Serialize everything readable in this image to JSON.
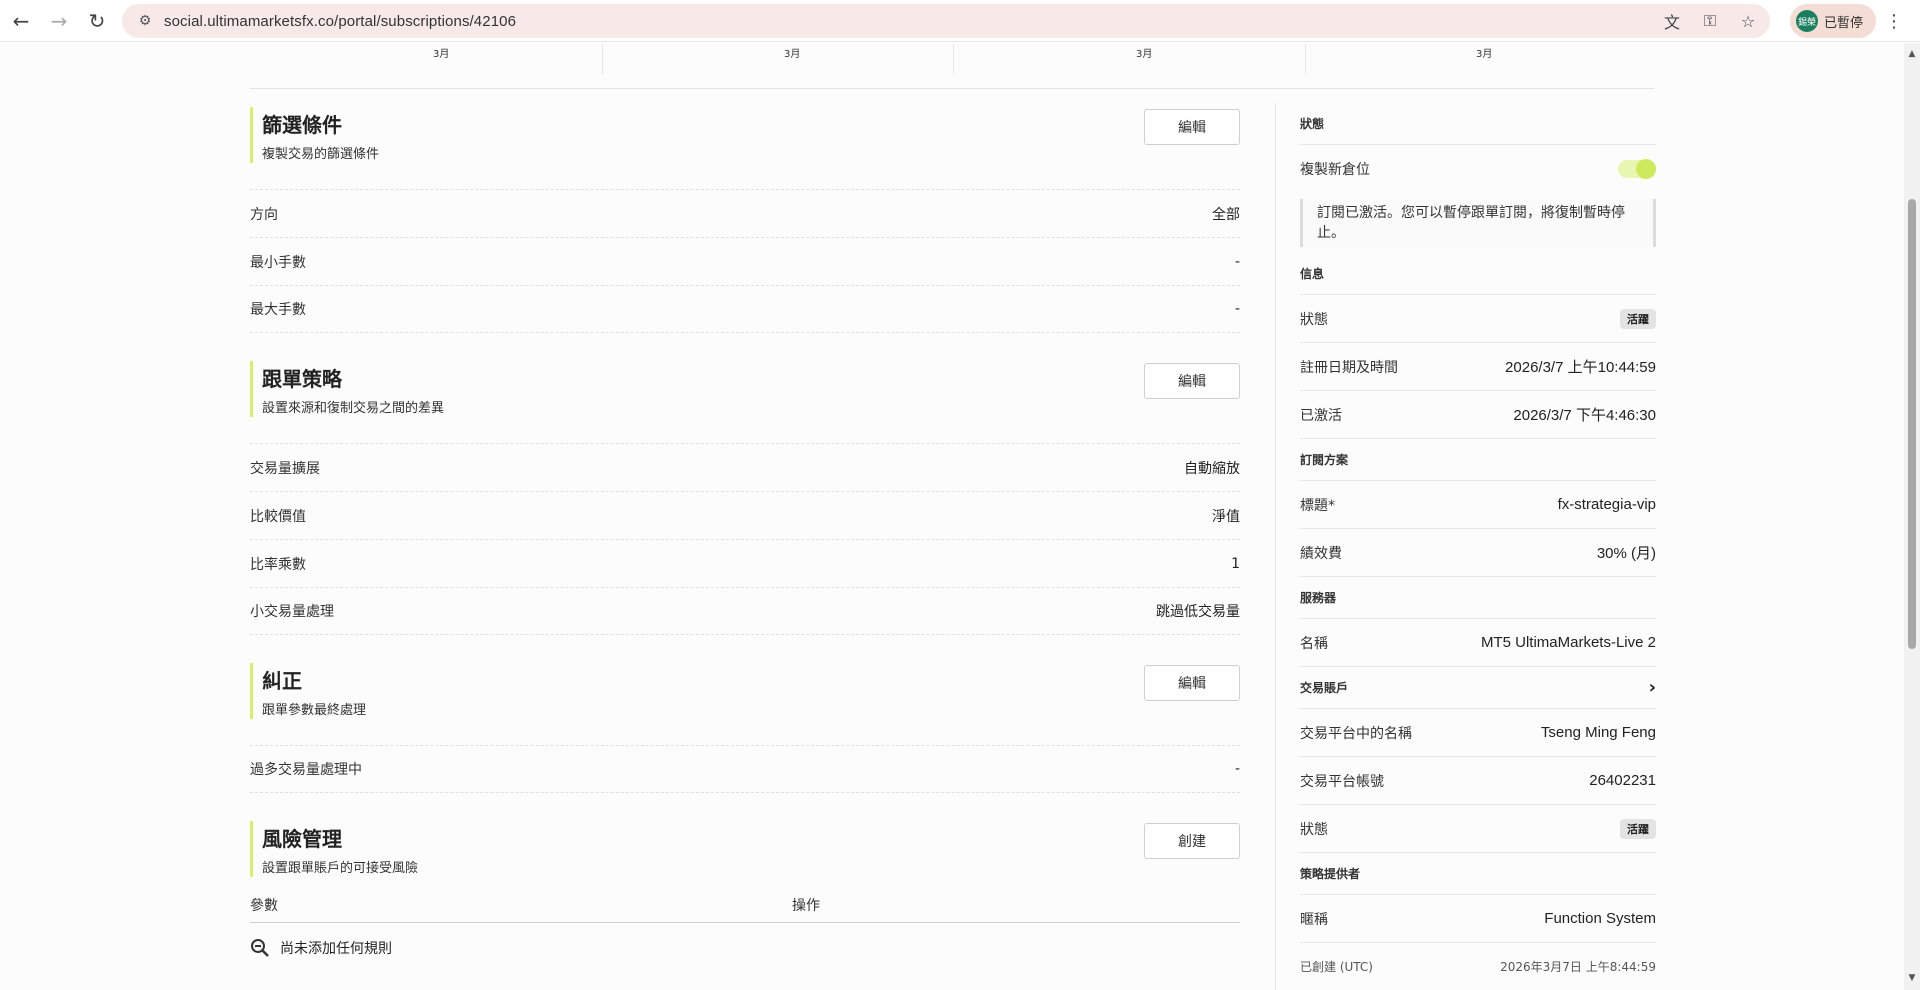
{
  "browser": {
    "url": "social.ultimamarketsfx.co/portal/subscriptions/42106",
    "profile_avatar": "錫榮",
    "profile_status": "已暫停"
  },
  "months": [
    "3月",
    "3月",
    "3月"
  ],
  "filters": {
    "title": "篩選條件",
    "subtitle": "複製交易的篩選條件",
    "button": "編輯",
    "rows": [
      {
        "label": "方向",
        "value": "全部"
      },
      {
        "label": "最小手數",
        "value": "-"
      },
      {
        "label": "最大手數",
        "value": "-"
      }
    ]
  },
  "strategy": {
    "title": "跟單策略",
    "subtitle": "設置來源和復制交易之間的差異",
    "button": "編輯",
    "rows": [
      {
        "label": "交易量擴展",
        "value": "自動縮放"
      },
      {
        "label": "比較價值",
        "value": "淨值"
      },
      {
        "label": "比率乘數",
        "value": "1"
      },
      {
        "label": "小交易量處理",
        "value": "跳過低交易量"
      }
    ]
  },
  "correction": {
    "title": "糾正",
    "subtitle": "跟單參數最終處理",
    "button": "編輯",
    "rows": [
      {
        "label": "過多交易量處理中",
        "value": "-"
      }
    ]
  },
  "risk": {
    "title": "風險管理",
    "subtitle": "設置跟單賬戶的可接受風險",
    "button": "創建",
    "col_param": "參數",
    "col_action": "操作",
    "empty": "尚未添加任何規則"
  },
  "sidebar": {
    "status_heading": "狀態",
    "copy_new_label": "複製新倉位",
    "notice": "訂閱已激活。您可以暫停跟單訂閱，將復制暫時停止。",
    "info_heading": "信息",
    "info_rows": [
      {
        "label": "狀態",
        "badge": "活躍"
      },
      {
        "label": "註冊日期及時間",
        "value": "2026/3/7 上午10:44:59"
      },
      {
        "label": "已激活",
        "value": "2026/3/7 下午4:46:30"
      }
    ],
    "plan_heading": "訂閱方案",
    "plan_rows": [
      {
        "label": "標題*",
        "value": "fx-strategia-vip"
      },
      {
        "label": "績效費",
        "value": "30% (月)"
      }
    ],
    "server_heading": "服務器",
    "server_rows": [
      {
        "label": "名稱",
        "value": "MT5 UltimaMarkets-Live 2"
      }
    ],
    "account_heading": "交易賬戶",
    "account_rows": [
      {
        "label": "交易平台中的名稱",
        "value": "Tseng Ming Feng"
      },
      {
        "label": "交易平台帳號",
        "value": "26402231"
      },
      {
        "label": "狀態",
        "badge": "活躍"
      }
    ],
    "provider_heading": "策略提供者",
    "provider_rows": [
      {
        "label": "暱稱",
        "value": "Function System"
      },
      {
        "label": "已創建 (UTC)",
        "value": "2026年3月7日 上午8:44:59"
      }
    ]
  }
}
